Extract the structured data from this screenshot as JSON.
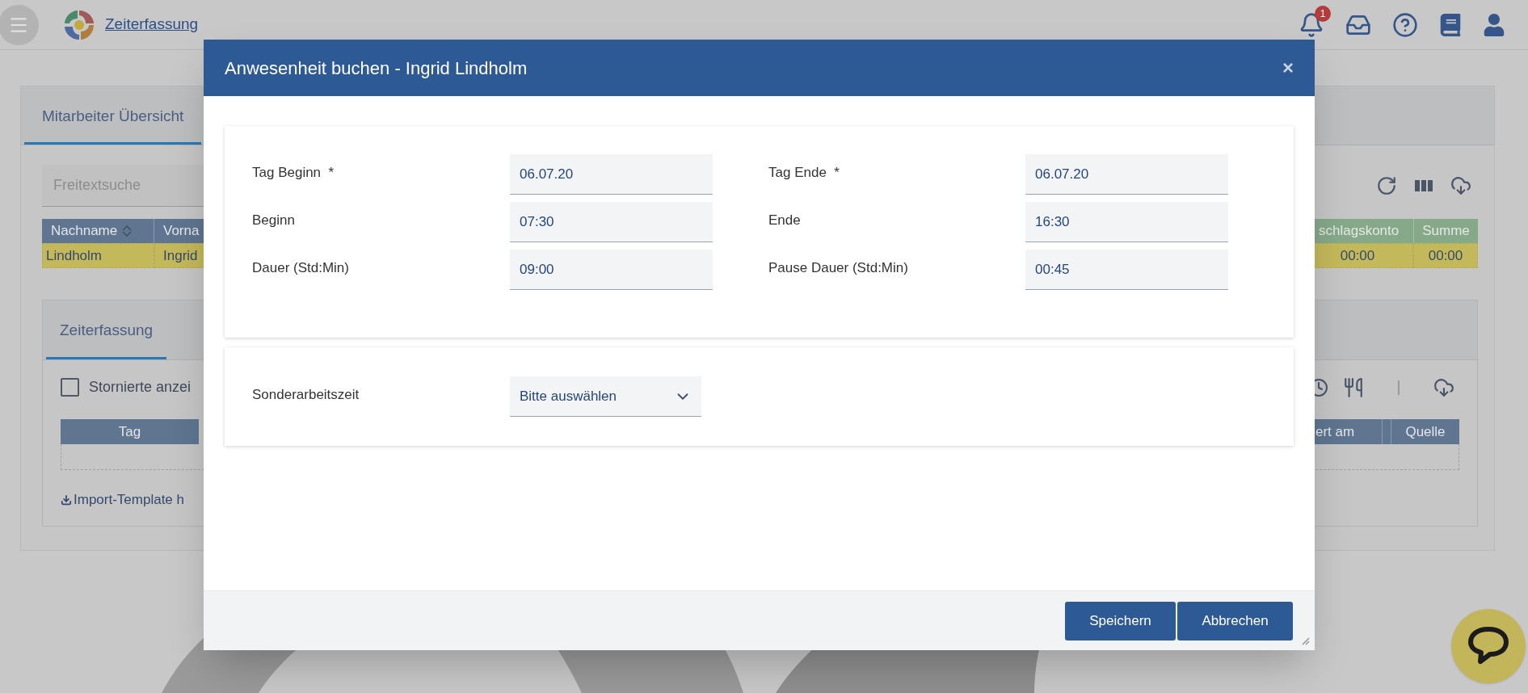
{
  "app_bar": {
    "title": "Zeiterfassung",
    "notification_count": "1"
  },
  "overview_panel": {
    "tab": "Mitarbeiter Übersicht",
    "search": {
      "placeholder": "Freitextsuche"
    },
    "columns_left": [
      "Nachname",
      "Vorna"
    ],
    "columns_right": [
      "schlagskonto",
      "Summe"
    ],
    "row": {
      "selected": true,
      "left": [
        "Lindholm",
        "Ingrid"
      ],
      "right": [
        "00:00",
        "00:00"
      ]
    }
  },
  "time_panel": {
    "tab": "Zeiterfassung",
    "show_cancelled": {
      "label": "Stornierte anzei",
      "checked": false
    },
    "columns_left": [
      "Tag"
    ],
    "columns_right": [
      "ert am",
      "Quelle"
    ],
    "import_link": "Import-Template h"
  },
  "dialog": {
    "title": "Anwesenheit buchen - Ingrid Lindholm",
    "close": "×",
    "required_mark": "*",
    "fields": [
      {
        "label": "Tag Beginn",
        "required": true,
        "value": "06.07.20"
      },
      {
        "label": "Tag Ende",
        "required": true,
        "value": "06.07.20"
      },
      {
        "label": "Beginn",
        "required": false,
        "value": "07:30"
      },
      {
        "label": "Ende",
        "required": false,
        "value": "16:30"
      },
      {
        "label": "Dauer (Std:Min)",
        "required": false,
        "value": "09:00"
      },
      {
        "label": "Pause Dauer (Std:Min)",
        "required": false,
        "value": "00:45"
      }
    ],
    "special_time": {
      "label": "Sonderarbeitszeit",
      "value": "Bitte auswählen"
    },
    "buttons": [
      "Speichern",
      "Abbrechen"
    ]
  }
}
